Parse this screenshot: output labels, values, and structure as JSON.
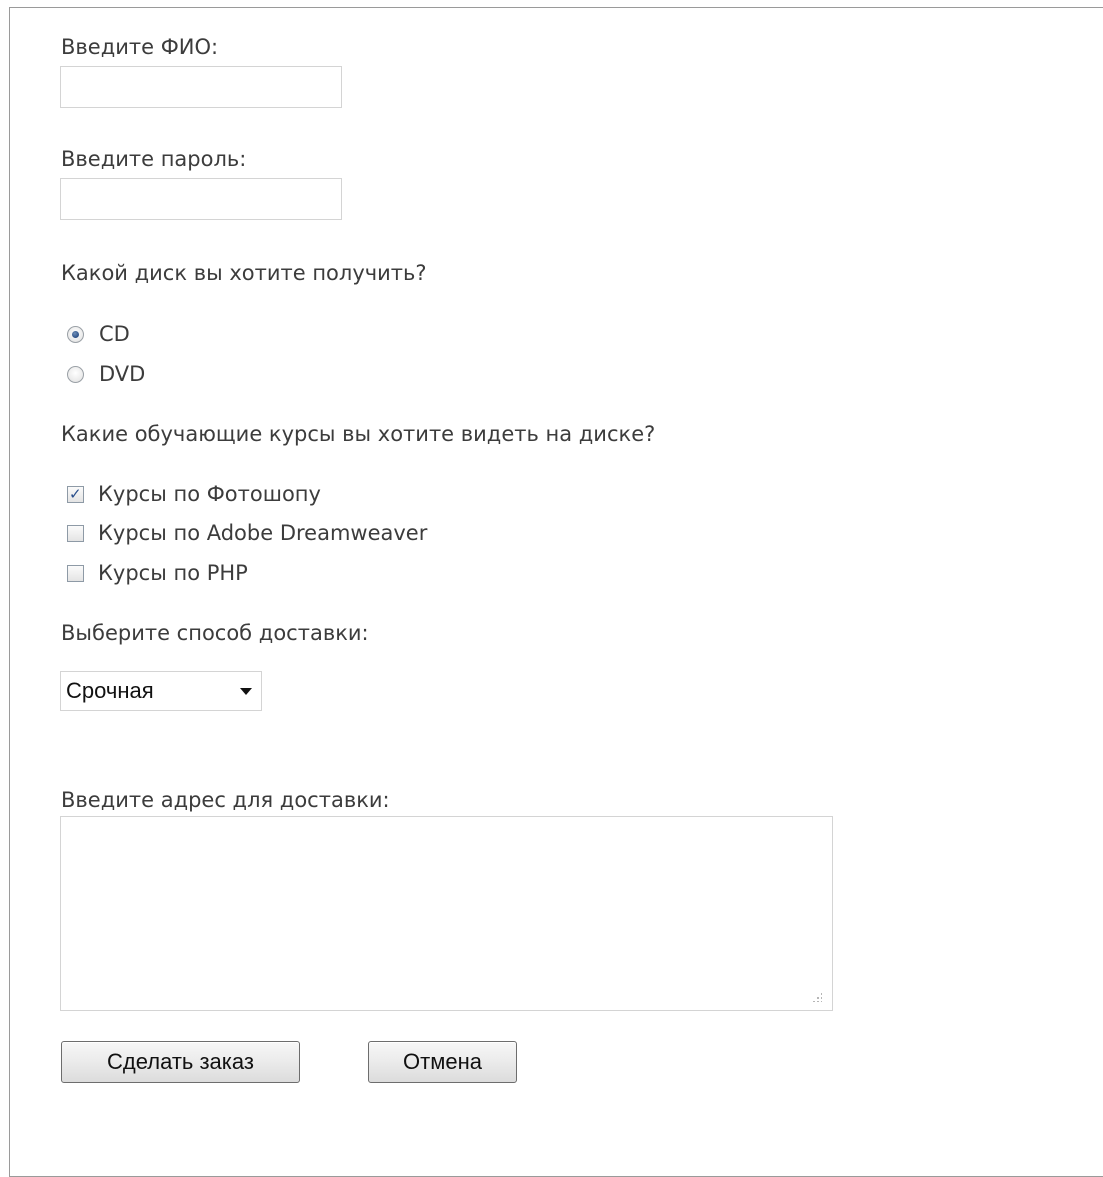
{
  "form": {
    "name_label": "Введите ФИО:",
    "name_value": "",
    "password_label": "Введите пароль:",
    "password_value": "",
    "disk_question": "Какой диск вы хотите получить?",
    "disk_options": [
      {
        "label": "CD",
        "checked": true
      },
      {
        "label": "DVD",
        "checked": false
      }
    ],
    "courses_question": "Какие обучающие курсы вы хотите видеть на диске?",
    "course_options": [
      {
        "label": "Курсы по Фотошопу",
        "checked": true
      },
      {
        "label": "Курсы по Adobe Dreamweaver",
        "checked": false
      },
      {
        "label": "Курсы по PHP",
        "checked": false
      }
    ],
    "delivery_label": "Выберите способ доставки:",
    "delivery_selected": "Срочная",
    "address_label": "Введите адрес для доставки:",
    "address_value": "",
    "submit_label": "Сделать заказ",
    "cancel_label": "Отмена"
  },
  "colors": {
    "label_text": "#3c3c3c",
    "field_border": "#d4d4d4",
    "button_border": "#6d6d6d",
    "frame_border": "#9a9a9a"
  },
  "icons": {
    "select_arrow": "chevron-down-icon",
    "textarea_grip": "resize-grip-icon"
  }
}
